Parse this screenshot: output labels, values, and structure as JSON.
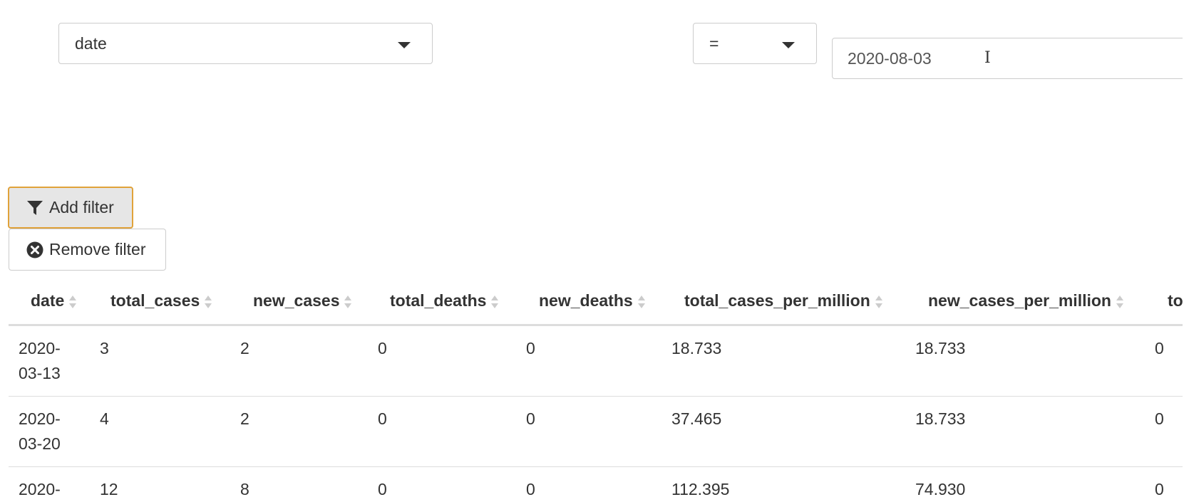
{
  "filter": {
    "column": "date",
    "operator": "=",
    "value": "2020-08-03"
  },
  "buttons": {
    "add_filter": "Add filter",
    "remove_filter": "Remove filter"
  },
  "table": {
    "columns": [
      "date",
      "total_cases",
      "new_cases",
      "total_deaths",
      "new_deaths",
      "total_cases_per_million",
      "new_cases_per_million",
      "to"
    ],
    "rows": [
      {
        "date_line1": "2020-",
        "date_line2": "03-13",
        "total_cases": "3",
        "new_cases": "2",
        "total_deaths": "0",
        "new_deaths": "0",
        "total_cases_per_million": "18.733",
        "new_cases_per_million": "18.733",
        "to": "0"
      },
      {
        "date_line1": "2020-",
        "date_line2": "03-20",
        "total_cases": "4",
        "new_cases": "2",
        "total_deaths": "0",
        "new_deaths": "0",
        "total_cases_per_million": "37.465",
        "new_cases_per_million": "18.733",
        "to": "0"
      },
      {
        "date_line1": "2020-",
        "date_line2": "",
        "total_cases": "12",
        "new_cases": "8",
        "total_deaths": "0",
        "new_deaths": "0",
        "total_cases_per_million": "112.395",
        "new_cases_per_million": "74.930",
        "to": "0"
      }
    ]
  },
  "colors": {
    "focus_border": "#e0a23a",
    "button_active_bg": "#e6e6e6",
    "border": "#cccccc",
    "text": "#333333"
  },
  "icons": {
    "add_filter": "filter-funnel-icon",
    "remove_filter": "times-circle-icon",
    "sort": "sort-both-icon",
    "dropdown": "caret-down-icon"
  }
}
